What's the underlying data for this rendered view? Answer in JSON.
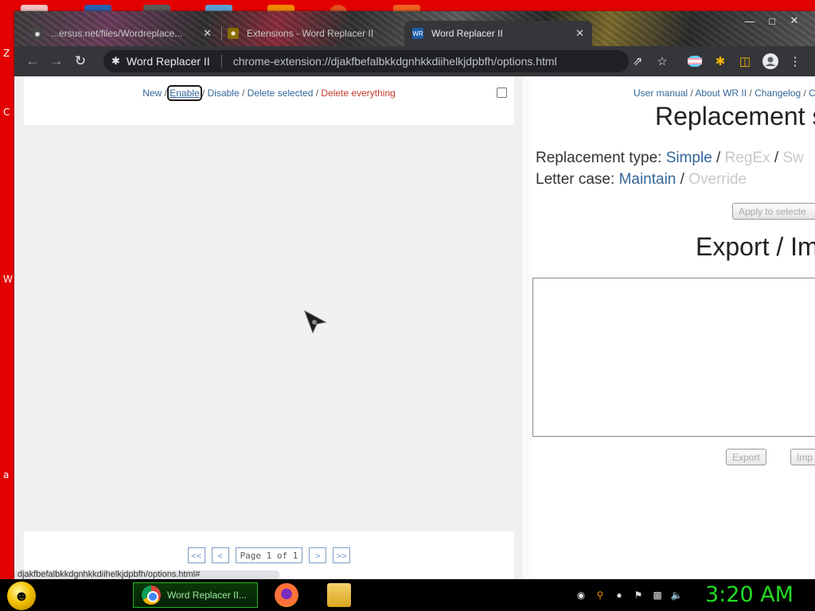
{
  "browser": {
    "tabs": [
      {
        "title": "...ersus.net/files/Wordreplace...",
        "active": false
      },
      {
        "title": "Extensions - Word Replacer II",
        "active": false
      },
      {
        "title": "Word Replacer II",
        "active": true
      }
    ],
    "toolbar": {
      "site_name": "Word Replacer II",
      "url": "chrome-extension://djakfbefalbkkdgnhkkdiihelkjdpbfh/options.html"
    },
    "status_url": "djakfbefalbkkdgnhkkdiihelkjdpbfh/options.html#"
  },
  "left_panel": {
    "actions": {
      "new": "New",
      "enable": "Enable",
      "disable": "Disable",
      "delete_selected": "Delete selected",
      "delete_everything": "Delete everything",
      "separator": " / "
    },
    "pager": {
      "first": "<<",
      "prev": "<",
      "info": "Page 1 of 1",
      "next": ">",
      "last": ">>"
    }
  },
  "right_panel": {
    "links": {
      "user_manual": "User manual",
      "about": "About WR II",
      "changelog": "Changelog",
      "truncated": "C"
    },
    "replacement_title": "Replacement s",
    "replacement_type": {
      "label": "Replacement type:",
      "simple": "Simple",
      "regex": "RegEx",
      "truncated": "Sw"
    },
    "letter_case": {
      "label": "Letter case:",
      "maintain": "Maintain",
      "override": "Override"
    },
    "apply_button": "Apply to selecte",
    "export_title": "Export / Im",
    "export_button": "Export",
    "import_button": "Imp"
  },
  "taskbar": {
    "chrome_label": "Word Replacer II...",
    "clock": "3:20 AM"
  },
  "colors": {
    "link": "#336699",
    "danger": "#c0392b",
    "clock": "#22dd22",
    "desktop": "#e30000"
  }
}
